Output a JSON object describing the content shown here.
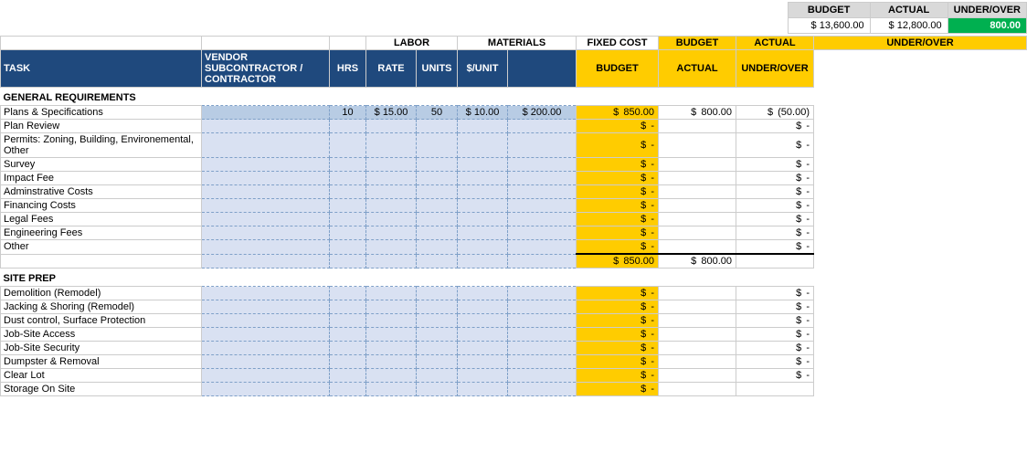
{
  "summary": {
    "budget_label": "BUDGET",
    "actual_label": "ACTUAL",
    "underover_label": "UNDER/OVER",
    "budget_val": "$ 13,600.00",
    "actual_val": "$ 12,800.00",
    "underover_val": "800.00",
    "budget_dollar": "$",
    "actual_dollar": "$",
    "underover_dollar": "$"
  },
  "col_headers_top": {
    "labor": "LABOR",
    "materials": "MATERIALS",
    "fixed_cost": "FIXED COST",
    "budget": "BUDGET",
    "actual": "ACTUAL",
    "underover": "UNDER/OVER"
  },
  "col_headers_bottom": {
    "task": "TASK",
    "vendor": "VENDOR\nSUBCONTRACTOR /\nCONTRACTOR",
    "hrs": "HRS",
    "rate": "RATE",
    "units": "UNITS",
    "unit_cost": "$/UNIT"
  },
  "sections": [
    {
      "title": "GENERAL REQUIREMENTS",
      "rows": [
        {
          "task": "Plans & Specifications",
          "vendor": "",
          "hrs": "10",
          "rate": "$ 15.00",
          "units": "50",
          "unit_cost": "$ 10.00",
          "fixed": "$ 200.00",
          "budget_dollar": "$",
          "budget_val": "850.00",
          "actual_dollar": "$",
          "actual_val": "800.00",
          "underover_dollar": "$",
          "underover_val": "(50.00)"
        },
        {
          "task": "Plan Review",
          "vendor": "",
          "hrs": "",
          "rate": "",
          "units": "",
          "unit_cost": "",
          "fixed": "",
          "budget_dollar": "$",
          "budget_val": "-",
          "actual_dollar": "",
          "actual_val": "",
          "underover_dollar": "$",
          "underover_val": "-"
        },
        {
          "task": "Permits: Zoning, Building, Environemental, Other",
          "vendor": "",
          "hrs": "",
          "rate": "",
          "units": "",
          "unit_cost": "",
          "fixed": "",
          "budget_dollar": "$",
          "budget_val": "-",
          "actual_dollar": "",
          "actual_val": "",
          "underover_dollar": "$",
          "underover_val": "-"
        },
        {
          "task": "Survey",
          "vendor": "",
          "hrs": "",
          "rate": "",
          "units": "",
          "unit_cost": "",
          "fixed": "",
          "budget_dollar": "$",
          "budget_val": "-",
          "actual_dollar": "",
          "actual_val": "",
          "underover_dollar": "$",
          "underover_val": "-"
        },
        {
          "task": "Impact Fee",
          "vendor": "",
          "hrs": "",
          "rate": "",
          "units": "",
          "unit_cost": "",
          "fixed": "",
          "budget_dollar": "$",
          "budget_val": "-",
          "actual_dollar": "",
          "actual_val": "",
          "underover_dollar": "$",
          "underover_val": "-"
        },
        {
          "task": "Adminstrative Costs",
          "vendor": "",
          "hrs": "",
          "rate": "",
          "units": "",
          "unit_cost": "",
          "fixed": "",
          "budget_dollar": "$",
          "budget_val": "-",
          "actual_dollar": "",
          "actual_val": "",
          "underover_dollar": "$",
          "underover_val": "-"
        },
        {
          "task": "Financing Costs",
          "vendor": "",
          "hrs": "",
          "rate": "",
          "units": "",
          "unit_cost": "",
          "fixed": "",
          "budget_dollar": "$",
          "budget_val": "-",
          "actual_dollar": "",
          "actual_val": "",
          "underover_dollar": "$",
          "underover_val": "-"
        },
        {
          "task": "Legal Fees",
          "vendor": "",
          "hrs": "",
          "rate": "",
          "units": "",
          "unit_cost": "",
          "fixed": "",
          "budget_dollar": "$",
          "budget_val": "-",
          "actual_dollar": "",
          "actual_val": "",
          "underover_dollar": "$",
          "underover_val": "-"
        },
        {
          "task": "Engineering Fees",
          "vendor": "",
          "hrs": "",
          "rate": "",
          "units": "",
          "unit_cost": "",
          "fixed": "",
          "budget_dollar": "$",
          "budget_val": "-",
          "actual_dollar": "",
          "actual_val": "",
          "underover_dollar": "$",
          "underover_val": "-"
        },
        {
          "task": "Other",
          "vendor": "",
          "hrs": "",
          "rate": "",
          "units": "",
          "unit_cost": "",
          "fixed": "",
          "budget_dollar": "$",
          "budget_val": "-",
          "actual_dollar": "",
          "actual_val": "",
          "underover_dollar": "$",
          "underover_val": "-"
        }
      ],
      "subtotal": {
        "budget_dollar": "$",
        "budget_val": "850.00",
        "actual_dollar": "$",
        "actual_val": "800.00",
        "underover_dollar": "",
        "underover_val": ""
      }
    },
    {
      "title": "SITE PREP",
      "rows": [
        {
          "task": "Demolition (Remodel)",
          "vendor": "",
          "hrs": "",
          "rate": "",
          "units": "",
          "unit_cost": "",
          "fixed": "",
          "budget_dollar": "$",
          "budget_val": "-",
          "actual_dollar": "",
          "actual_val": "",
          "underover_dollar": "$",
          "underover_val": "-"
        },
        {
          "task": "Jacking & Shoring (Remodel)",
          "vendor": "",
          "hrs": "",
          "rate": "",
          "units": "",
          "unit_cost": "",
          "fixed": "",
          "budget_dollar": "$",
          "budget_val": "-",
          "actual_dollar": "",
          "actual_val": "",
          "underover_dollar": "$",
          "underover_val": "-"
        },
        {
          "task": "Dust control, Surface Protection",
          "vendor": "",
          "hrs": "",
          "rate": "",
          "units": "",
          "unit_cost": "",
          "fixed": "",
          "budget_dollar": "$",
          "budget_val": "-",
          "actual_dollar": "",
          "actual_val": "",
          "underover_dollar": "$",
          "underover_val": "-"
        },
        {
          "task": "Job-Site Access",
          "vendor": "",
          "hrs": "",
          "rate": "",
          "units": "",
          "unit_cost": "",
          "fixed": "",
          "budget_dollar": "$",
          "budget_val": "-",
          "actual_dollar": "",
          "actual_val": "",
          "underover_dollar": "$",
          "underover_val": "-"
        },
        {
          "task": "Job-Site Security",
          "vendor": "",
          "hrs": "",
          "rate": "",
          "units": "",
          "unit_cost": "",
          "fixed": "",
          "budget_dollar": "$",
          "budget_val": "-",
          "actual_dollar": "",
          "actual_val": "",
          "underover_dollar": "$",
          "underover_val": "-"
        },
        {
          "task": "Dumpster & Removal",
          "vendor": "",
          "hrs": "",
          "rate": "",
          "units": "",
          "unit_cost": "",
          "fixed": "",
          "budget_dollar": "$",
          "budget_val": "-",
          "actual_dollar": "",
          "actual_val": "",
          "underover_dollar": "$",
          "underover_val": "-"
        },
        {
          "task": "Clear Lot",
          "vendor": "",
          "hrs": "",
          "rate": "",
          "units": "",
          "unit_cost": "",
          "fixed": "",
          "budget_dollar": "$",
          "budget_val": "-",
          "actual_dollar": "",
          "actual_val": "",
          "underover_dollar": "$",
          "underover_val": "-"
        },
        {
          "task": "Storage On Site",
          "vendor": "",
          "hrs": "",
          "rate": "",
          "units": "",
          "unit_cost": "",
          "fixed": "",
          "budget_dollar": "$",
          "budget_val": "-",
          "actual_dollar": "",
          "actual_val": "",
          "underover_dollar": "",
          "underover_val": ""
        }
      ]
    }
  ]
}
